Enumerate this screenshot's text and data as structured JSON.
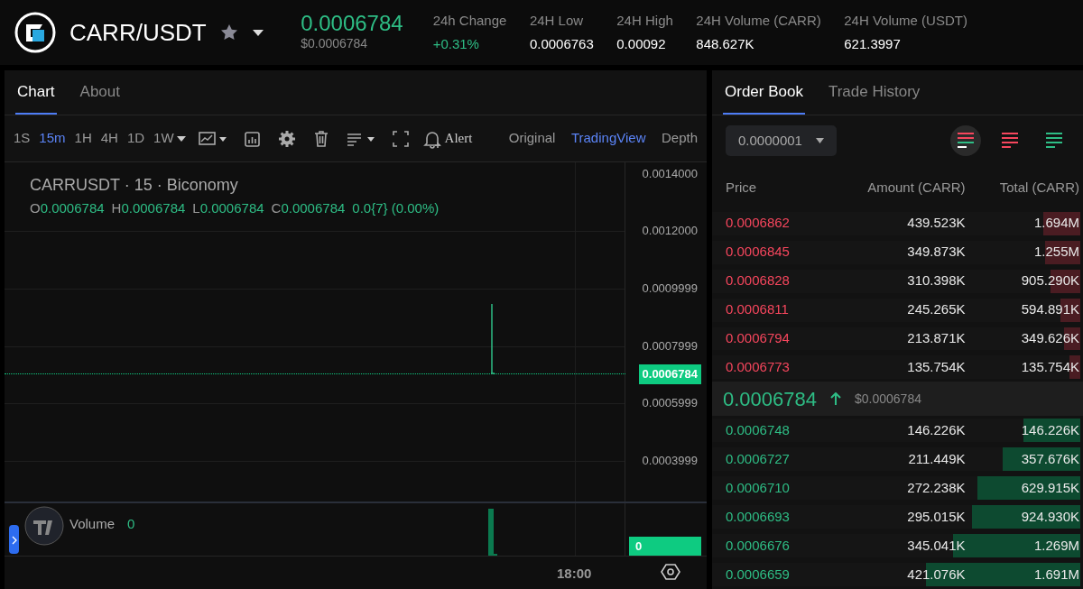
{
  "header": {
    "pair": "CARR/USDT",
    "favorite": false,
    "price": "0.0006784",
    "price_usd": "$0.0006784",
    "stats": [
      {
        "label": "24h Change",
        "value": "+0.31%",
        "kind": "up"
      },
      {
        "label": "24H Low",
        "value": "0.0006763",
        "kind": "plain"
      },
      {
        "label": "24H High",
        "value": "0.00092",
        "kind": "plain"
      },
      {
        "label": "24H Volume (CARR)",
        "value": "848.627K",
        "kind": "plain"
      },
      {
        "label": "24H Volume (USDT)",
        "value": "621.3997",
        "kind": "plain"
      }
    ]
  },
  "chart_panel": {
    "tabs": [
      {
        "label": "Chart",
        "selected": true
      },
      {
        "label": "About",
        "selected": false
      }
    ],
    "intervals": [
      {
        "label": "1S",
        "selected": false
      },
      {
        "label": "15m",
        "selected": true
      },
      {
        "label": "1H",
        "selected": false
      },
      {
        "label": "4H",
        "selected": false
      },
      {
        "label": "1D",
        "selected": false
      },
      {
        "label": "1W",
        "selected": false
      }
    ],
    "alert_label": "Alert",
    "views": [
      {
        "label": "Original",
        "selected": false
      },
      {
        "label": "TradingView",
        "selected": true
      },
      {
        "label": "Depth",
        "selected": false
      }
    ],
    "symbol_line": "CARRUSDT · 15 · Biconomy",
    "ohlc": [
      {
        "key": "O",
        "value": "0.0006784"
      },
      {
        "key": "H",
        "value": "0.0006784"
      },
      {
        "key": "L",
        "value": "0.0006784"
      },
      {
        "key": "C",
        "value": "0.0006784"
      }
    ],
    "change": "0.0{7} (0.00%)",
    "price_axis": [
      "0.0014000",
      "0.0012000",
      "0.0009999",
      "0.0007999",
      "0.0005999",
      "0.0003999"
    ],
    "last_price_tag": "0.0006784",
    "volume_label": "Volume",
    "volume_value": "0",
    "volume_tag": "0",
    "time_label": "18:00"
  },
  "order_book": {
    "tabs": [
      {
        "label": "Order Book",
        "selected": true
      },
      {
        "label": "Trade History",
        "selected": false
      }
    ],
    "precision": "0.0000001",
    "modes": [
      {
        "kind": "both",
        "selected": true
      },
      {
        "kind": "asks",
        "selected": false
      },
      {
        "kind": "bids",
        "selected": false
      }
    ],
    "columns": [
      "Price",
      "Amount (CARR)",
      "Total (CARR)"
    ],
    "asks": [
      {
        "price": "0.0006862",
        "amount": "439.523K",
        "total": "1.694M",
        "level": 0.1
      },
      {
        "price": "0.0006845",
        "amount": "349.873K",
        "total": "1.255M",
        "level": 0.095
      },
      {
        "price": "0.0006828",
        "amount": "310.398K",
        "total": "905.290K",
        "level": 0.08
      },
      {
        "price": "0.0006811",
        "amount": "245.265K",
        "total": "594.891K",
        "level": 0.055
      },
      {
        "price": "0.0006794",
        "amount": "213.871K",
        "total": "349.626K",
        "level": 0.045
      },
      {
        "price": "0.0006773",
        "amount": "135.754K",
        "total": "135.754K",
        "level": 0.03
      }
    ],
    "last": {
      "price": "0.0006784",
      "usd": "$0.0006784"
    },
    "bids": [
      {
        "price": "0.0006748",
        "amount": "146.226K",
        "total": "146.226K",
        "level": 0.155
      },
      {
        "price": "0.0006727",
        "amount": "211.449K",
        "total": "357.676K",
        "level": 0.21
      },
      {
        "price": "0.0006710",
        "amount": "272.238K",
        "total": "629.915K",
        "level": 0.28
      },
      {
        "price": "0.0006693",
        "amount": "295.015K",
        "total": "924.930K",
        "level": 0.295
      },
      {
        "price": "0.0006676",
        "amount": "345.041K",
        "total": "1.269M",
        "level": 0.345
      },
      {
        "price": "0.0006659",
        "amount": "421.076K",
        "total": "1.691M",
        "level": 0.42
      }
    ]
  }
}
